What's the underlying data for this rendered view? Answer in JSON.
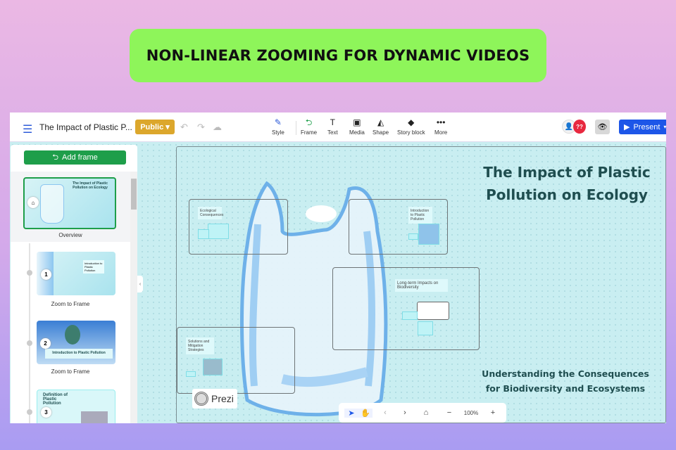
{
  "banner": {
    "text": "NON-LINEAR ZOOMING FOR DYNAMIC VIDEOS"
  },
  "toolbar": {
    "menu_icon": "☰",
    "title": "The Impact of Plastic P...",
    "visibility": "Public ▾",
    "tools": [
      {
        "label": "Style",
        "icon": "✎"
      },
      {
        "label": "Frame",
        "icon": "⮌"
      },
      {
        "label": "Text",
        "icon": "T"
      },
      {
        "label": "Media",
        "icon": "▣"
      },
      {
        "label": "Shape",
        "icon": "◭"
      },
      {
        "label": "Story block",
        "icon": "◆"
      },
      {
        "label": "More",
        "icon": "•••"
      }
    ],
    "collab_badge": "??",
    "present": "Present"
  },
  "sidebar": {
    "add_frame": "Add frame",
    "overview_label": "Overview",
    "overview_title": "The Impact of Plastic Pollution on Ecology",
    "frames": [
      {
        "number": "1",
        "label": "Zoom to Frame",
        "title": "Introduction to Plastic Pollution"
      },
      {
        "number": "2",
        "label": "Zoom to Frame",
        "title": "Introduction to Plastic Pollution"
      },
      {
        "number": "3",
        "title": "Definition of Plastic Pollution"
      }
    ]
  },
  "canvas": {
    "title": "The Impact of Plastic Pollution on Ecology",
    "subtitle": "Understanding the Consequences for Biodiversity and Ecosystems",
    "frames": [
      "Ecological Consequences",
      "Introduction to Plastic Pollution",
      "Long-term Impacts on Biodiversity",
      "Solutions and Mitigation Strategies"
    ],
    "logo": "Prezi"
  },
  "navbar": {
    "zoom": "100%"
  },
  "colors": {
    "banner": "#8ef55a",
    "public": "#dca72c",
    "present": "#1d56e8",
    "add_frame": "#1e9e4a",
    "heading": "#1f4e50"
  }
}
